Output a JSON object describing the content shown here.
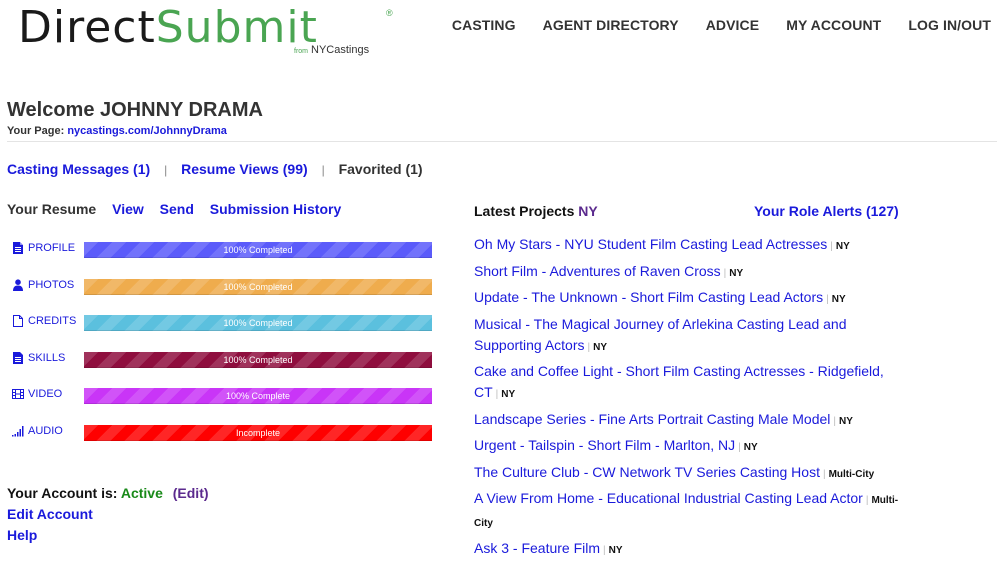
{
  "header": {
    "logo": {
      "part1": "Direct",
      "part2": "Submit",
      "registered": "®",
      "from": "from",
      "brand": "NYCastings"
    },
    "nav": [
      "CASTING",
      "AGENT DIRECTORY",
      "ADVICE",
      "MY ACCOUNT",
      "LOG IN/OUT"
    ]
  },
  "welcome": {
    "title": "Welcome JOHNNY DRAMA",
    "your_page_label": "Your Page:",
    "your_page_link": "nycastings.com/JohnnyDrama"
  },
  "stats": {
    "casting_messages": "Casting Messages (1)",
    "resume_views": "Resume Views (99)",
    "favorited": "Favorited (1)",
    "separator": "|"
  },
  "resume": {
    "heading": "Your Resume",
    "links": {
      "view": "View",
      "send": "Send",
      "history": "Submission History"
    },
    "sections": [
      {
        "label": "PROFILE",
        "icon": "document-icon",
        "status": "100% Completed",
        "progress": 100,
        "color": "#5b5bfa"
      },
      {
        "label": "PHOTOS",
        "icon": "user-icon",
        "status": "100% Completed",
        "progress": 100,
        "color": "#efac4d"
      },
      {
        "label": "CREDITS",
        "icon": "file-outline-icon",
        "status": "100% Completed",
        "progress": 100,
        "color": "#5bc0de"
      },
      {
        "label": "SKILLS",
        "icon": "document-icon",
        "status": "100% Completed",
        "progress": 100,
        "color": "#8f0e3e"
      },
      {
        "label": "VIDEO",
        "icon": "film-icon",
        "status": "100% Complete",
        "progress": 100,
        "color": "#c935f7"
      },
      {
        "label": "AUDIO",
        "icon": "signal-icon",
        "status": "Incomplete",
        "progress": 100,
        "color": "#ff0000"
      }
    ]
  },
  "account": {
    "label": "Your Account is:",
    "status": "Active",
    "edit": "(Edit)",
    "edit_account": "Edit Account",
    "help": "Help"
  },
  "projects": {
    "heading": "Latest Projects",
    "region": "NY",
    "alerts": "Your Role Alerts (127)",
    "items": [
      {
        "title": "Oh My Stars - NYU Student Film Casting Lead Actresses",
        "location": "NY"
      },
      {
        "title": "Short Film - Adventures of Raven Cross",
        "location": "NY"
      },
      {
        "title": "Update - The Unknown - Short Film Casting Lead Actors",
        "location": "NY"
      },
      {
        "title": "Musical - The Magical Journey of Arlekina Casting Lead and Supporting Actors",
        "location": "NY"
      },
      {
        "title": "Cake and Coffee Light - Short Film Casting Actresses - Ridgefield, CT",
        "location": "NY"
      },
      {
        "title": "Landscape Series - Fine Arts Portrait Casting Male Model",
        "location": "NY"
      },
      {
        "title": "Urgent - Tailspin - Short Film - Marlton, NJ",
        "location": "NY"
      },
      {
        "title": "The Culture Club - CW Network TV Series Casting Host",
        "location": "Multi-City"
      },
      {
        "title": "A View From Home - Educational Industrial Casting Lead Actor",
        "location": "Multi-City"
      },
      {
        "title": "Ask 3 - Feature Film",
        "location": "NY"
      }
    ]
  }
}
